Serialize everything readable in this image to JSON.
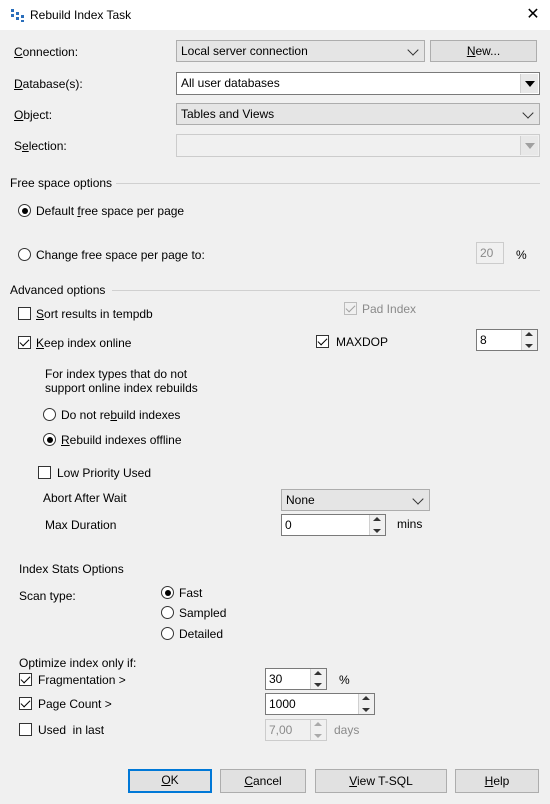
{
  "window": {
    "title": "Rebuild Index Task",
    "close_glyph": "✕"
  },
  "connection": {
    "label": "Connection:",
    "value": "Local server connection",
    "new_button": "New..."
  },
  "databases": {
    "label": "Database(s):",
    "value": "All user databases"
  },
  "object": {
    "label": "Object:",
    "value": "Tables and Views"
  },
  "selection": {
    "label": "Selection:",
    "value": ""
  },
  "free_space": {
    "header": "Free space options",
    "default_option": "Default free space per page",
    "change_option": "Change free space per page to:",
    "percent_value": "20",
    "percent_unit": "%",
    "selected": "default"
  },
  "advanced": {
    "header": "Advanced options",
    "sort_tempdb": {
      "label": "Sort results in tempdb",
      "checked": false
    },
    "pad_index": {
      "label": "Pad Index",
      "checked": true,
      "enabled": false
    },
    "keep_online": {
      "label": "Keep index online",
      "checked": true
    },
    "maxdop": {
      "label": "MAXDOP",
      "checked": true,
      "value": "8"
    },
    "note_line1": "For index types that do not",
    "note_line2": "support online index rebuilds",
    "do_not_rebuild": "Do not rebuild indexes",
    "rebuild_offline": "Rebuild indexes offline",
    "offline_selected": "rebuild_offline",
    "low_priority": {
      "label": "Low Priority Used",
      "checked": false
    },
    "abort_after_wait": {
      "label": "Abort After Wait",
      "value": "None"
    },
    "max_duration": {
      "label": "Max Duration",
      "value": "0",
      "unit": "mins"
    }
  },
  "index_stats": {
    "header": "Index Stats Options",
    "scan_type_label": "Scan type:",
    "scan_options": [
      "Fast",
      "Sampled",
      "Detailed"
    ],
    "scan_selected": "Fast"
  },
  "optimize": {
    "header": "Optimize index only if:",
    "fragmentation": {
      "label": "Fragmentation >",
      "checked": true,
      "value": "30",
      "unit": "%"
    },
    "page_count": {
      "label": "Page Count >",
      "checked": true,
      "value": "1000"
    },
    "used_in_last": {
      "label": "Used  in last",
      "checked": false,
      "value": "7,00",
      "unit": "days"
    }
  },
  "buttons": {
    "ok": "OK",
    "cancel": "Cancel",
    "view_tsql": "View T-SQL",
    "help": "Help"
  }
}
